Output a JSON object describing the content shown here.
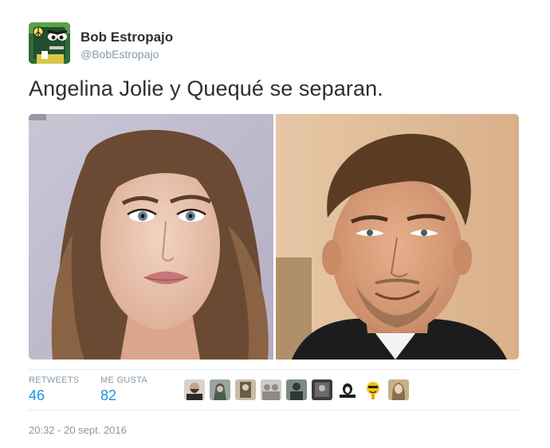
{
  "user": {
    "name": "Bob Estropajo",
    "handle": "@BobEstropajo"
  },
  "tweet": {
    "text": "Angelina Jolie y Quequé se separan."
  },
  "stats": {
    "retweets_label": "RETWEETS",
    "retweets_count": "46",
    "likes_label": "ME GUSTA",
    "likes_count": "82"
  },
  "likers": [
    {
      "icon": "avatar-bearded-man",
      "color": "#3a3330"
    },
    {
      "icon": "avatar-hooded-figure",
      "color": "#4c5a52"
    },
    {
      "icon": "avatar-dark-portrait",
      "color": "#6a5c4a"
    },
    {
      "icon": "avatar-group-photo",
      "color": "#8f8a86"
    },
    {
      "icon": "avatar-gray-figure",
      "color": "#2e3a36"
    },
    {
      "icon": "avatar-bw-photo",
      "color": "#3d3d3d"
    },
    {
      "icon": "avatar-penguin-dj",
      "color": "#1e1e1e"
    },
    {
      "icon": "avatar-yellow-emoji",
      "color": "#f4c20d"
    },
    {
      "icon": "avatar-long-hair",
      "color": "#8a6f4e"
    }
  ],
  "timestamp": "20:32 - 20 sept. 2016",
  "colors": {
    "link_blue": "#1b95e0",
    "text_dark": "#292f33",
    "text_gray": "#8899a6",
    "divider": "#e1e8ed"
  }
}
